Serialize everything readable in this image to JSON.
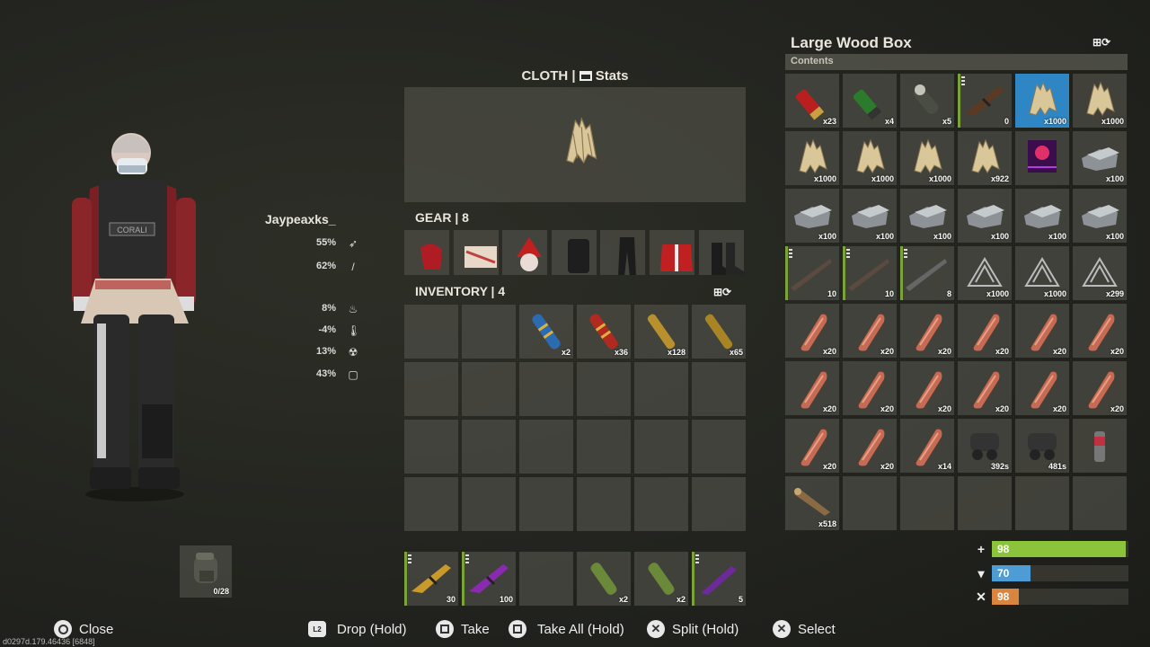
{
  "player": {
    "name": "Jaypeaxks_"
  },
  "stats": [
    {
      "value": "55%",
      "icon": "projectile-protection-icon"
    },
    {
      "value": "62%",
      "icon": "melee-protection-icon"
    },
    {
      "value": "8%",
      "icon": "bite-protection-icon"
    },
    {
      "value": "-4%",
      "icon": "cold-protection-icon"
    },
    {
      "value": "13%",
      "icon": "radiation-protection-icon"
    },
    {
      "value": "43%",
      "icon": "explosion-protection-icon"
    }
  ],
  "clothing_panel": {
    "title": "CLOTH | ",
    "title_suffix": "Stats"
  },
  "gear": {
    "title": "GEAR | 8",
    "items": [
      "red-gloves",
      "santa-pants-wrap",
      "santa-hat",
      "armored-vest",
      "black-pants",
      "santa-jacket",
      "boots"
    ]
  },
  "inventory": {
    "title": "INVENTORY | 4",
    "items": [
      {
        "slot": 2,
        "item": "blue-rocket",
        "qty": "x2"
      },
      {
        "slot": 3,
        "item": "red-rocket",
        "qty": "x36"
      },
      {
        "slot": 4,
        "item": "rifle-ammo",
        "qty": "x128"
      },
      {
        "slot": 5,
        "item": "rifle-ammo-hv",
        "qty": "x65"
      }
    ]
  },
  "belt": {
    "items": [
      {
        "item": "ak-rifle-gold",
        "qty": "30",
        "dots": true
      },
      {
        "item": "ak-rifle-purple",
        "qty": "100",
        "dots": true
      },
      {
        "item": "empty",
        "qty": ""
      },
      {
        "item": "grenade-green",
        "qty": "x2"
      },
      {
        "item": "grenade-green",
        "qty": "x2"
      },
      {
        "item": "smg-purple",
        "qty": "5",
        "dots": true
      }
    ]
  },
  "backpack": {
    "qty": "0/28"
  },
  "container": {
    "title": "Large Wood Box",
    "contents_label": "Contents",
    "items": [
      {
        "item": "shotgun-shell-red",
        "qty": "x23"
      },
      {
        "item": "shotgun-shell-green",
        "qty": "x4"
      },
      {
        "item": "grenade-round",
        "qty": "x5"
      },
      {
        "item": "ak-rifle",
        "qty": "0",
        "dots": true
      },
      {
        "item": "cloth",
        "qty": "x1000",
        "selected": true
      },
      {
        "item": "cloth",
        "qty": "x1000"
      },
      {
        "item": "cloth",
        "qty": "x1000"
      },
      {
        "item": "cloth",
        "qty": "x1000"
      },
      {
        "item": "cloth",
        "qty": "x1000"
      },
      {
        "item": "cloth",
        "qty": "x922"
      },
      {
        "item": "poster",
        "qty": ""
      },
      {
        "item": "metal-fragments",
        "qty": "x100"
      },
      {
        "item": "metal-fragments",
        "qty": "x100"
      },
      {
        "item": "metal-fragments",
        "qty": "x100"
      },
      {
        "item": "metal-fragments",
        "qty": "x100"
      },
      {
        "item": "metal-fragments",
        "qty": "x100"
      },
      {
        "item": "metal-fragments",
        "qty": "x100"
      },
      {
        "item": "metal-fragments",
        "qty": "x100"
      },
      {
        "item": "bolt-rifle",
        "qty": "10",
        "dots": true
      },
      {
        "item": "bolt-rifle",
        "qty": "10",
        "dots": true
      },
      {
        "item": "semi-rifle",
        "qty": "8",
        "dots": true
      },
      {
        "item": "metal-spring",
        "qty": "x1000"
      },
      {
        "item": "metal-spring",
        "qty": "x1000"
      },
      {
        "item": "metal-spring",
        "qty": "x299"
      },
      {
        "item": "meat",
        "qty": "x20"
      },
      {
        "item": "meat",
        "qty": "x20"
      },
      {
        "item": "meat",
        "qty": "x20"
      },
      {
        "item": "meat",
        "qty": "x20"
      },
      {
        "item": "meat",
        "qty": "x20"
      },
      {
        "item": "meat",
        "qty": "x20"
      },
      {
        "item": "meat",
        "qty": "x20"
      },
      {
        "item": "meat",
        "qty": "x20"
      },
      {
        "item": "meat",
        "qty": "x20"
      },
      {
        "item": "meat",
        "qty": "x20"
      },
      {
        "item": "meat",
        "qty": "x20"
      },
      {
        "item": "meat",
        "qty": "x20"
      },
      {
        "item": "meat",
        "qty": "x20"
      },
      {
        "item": "meat",
        "qty": "x20"
      },
      {
        "item": "meat",
        "qty": "x14"
      },
      {
        "item": "night-vision-goggles",
        "qty": "392s"
      },
      {
        "item": "night-vision-goggles",
        "qty": "481s"
      },
      {
        "item": "spray-can",
        "qty": ""
      },
      {
        "item": "wood",
        "qty": "x518"
      },
      {
        "item": "empty",
        "qty": ""
      },
      {
        "item": "empty",
        "qty": ""
      },
      {
        "item": "empty",
        "qty": ""
      },
      {
        "item": "empty",
        "qty": ""
      },
      {
        "item": "empty",
        "qty": ""
      }
    ]
  },
  "vitals": {
    "health": "98",
    "hydration": "70",
    "food": "98",
    "health_fraction": 0.98,
    "hydration_fraction": 0.28,
    "food_fraction": 0.2,
    "health_color": "#8bc43a",
    "hydration_color": "#4e9cd6",
    "food_color": "#d9843f"
  },
  "controls": {
    "close": "Close",
    "drop": "Drop (Hold)",
    "take": "Take",
    "take_all": "Take All (Hold)",
    "split": "Split (Hold)",
    "select": "Select",
    "l2_label": "L2"
  },
  "debug": {
    "text": "d0297d.179.46436 [6848]"
  }
}
